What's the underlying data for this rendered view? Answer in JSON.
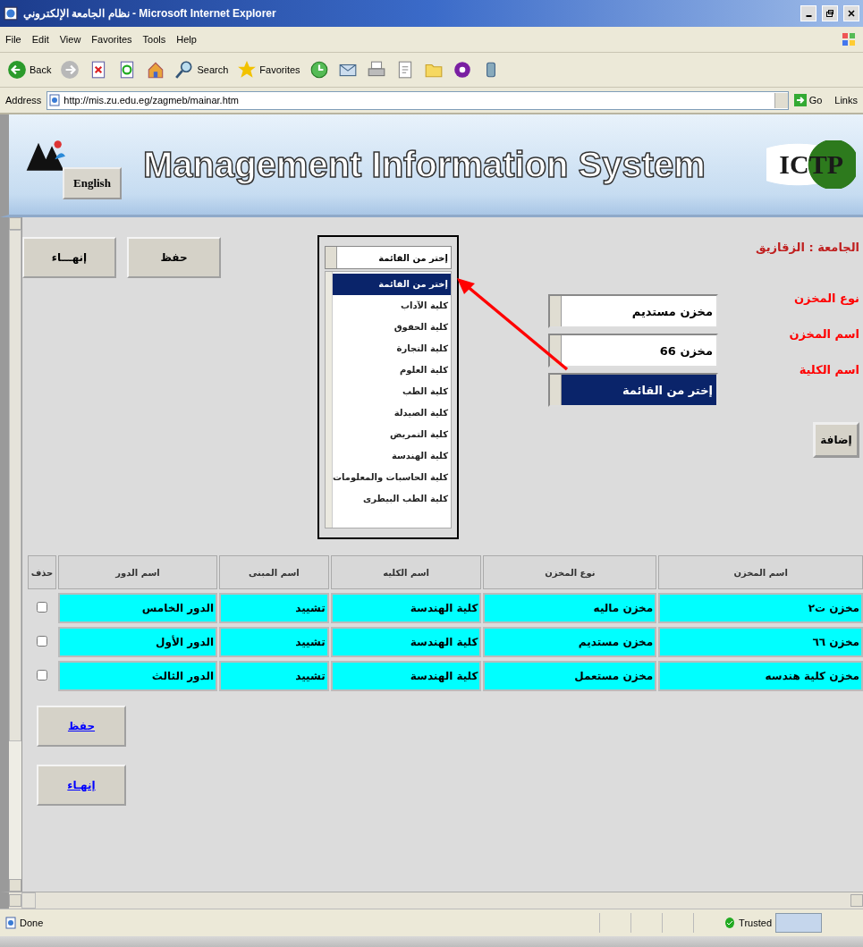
{
  "window": {
    "title": "نظام الجامعة الإلكتروني - Microsoft Internet Explorer"
  },
  "menu": {
    "file": "File",
    "edit": "Edit",
    "view": "View",
    "favorites": "Favorites",
    "tools": "Tools",
    "help": "Help"
  },
  "toolbar": {
    "back": "Back",
    "search": "Search",
    "favorites": "Favorites"
  },
  "address": {
    "label": "Address",
    "value": "http://mis.zu.edu.eg/zagmeb/mainar.htm",
    "go": "Go",
    "links": "Links"
  },
  "banner": {
    "title": "Management Information System",
    "language_button": "English",
    "logo_text": "ICTP"
  },
  "top_buttons": [
    "حفظ",
    "إنهـــاء"
  ],
  "list": {
    "header": "إختر من القائمة",
    "items": [
      {
        "label": "إختر من القائمة",
        "selected": true
      },
      {
        "label": "كلية الآداب",
        "selected": false
      },
      {
        "label": "كلية الحقوق",
        "selected": false
      },
      {
        "label": "كلية التجارة",
        "selected": false
      },
      {
        "label": "كلية العلوم",
        "selected": false
      },
      {
        "label": "كلية الطب",
        "selected": false
      },
      {
        "label": "كلية الصيدلة",
        "selected": false
      },
      {
        "label": "كلية التمريض",
        "selected": false
      },
      {
        "label": "كلية الهندسة",
        "selected": false
      },
      {
        "label": "كلية الحاسبات والمعلومات",
        "selected": false
      },
      {
        "label": "كلية الطب البيطرى",
        "selected": false
      }
    ]
  },
  "university": "الجامعة : الزقازيق",
  "fields": [
    {
      "label": "نوع المخزن",
      "value": "مخزن مستديم",
      "focused": false
    },
    {
      "label": "اسم المخزن",
      "value": "مخزن 66",
      "focused": false
    },
    {
      "label": "اسم الكلية",
      "value": "إختر من القائمة",
      "focused": true
    }
  ],
  "add_button": "إضافة",
  "table": {
    "columns": [
      "اسم المخزن",
      "نوع المخزن",
      "اسم الكليه",
      "اسم المبنى",
      "اسم الدور",
      "حذف"
    ],
    "rows": [
      {
        "cells": [
          "مخزن ت٢",
          "مخزن ماليه",
          "كلية  الهندسة",
          "تشييد",
          "الدور الخامس"
        ],
        "checked": false
      },
      {
        "cells": [
          "مخزن ٦٦",
          "مخزن مستديم",
          "كلية  الهندسة",
          "تشييد",
          "الدور الأول"
        ],
        "checked": false
      },
      {
        "cells": [
          "مخزن كلية هندسه",
          "مخزن مستعمل",
          "كلية  الهندسة",
          "تشييد",
          "الدور الثالث"
        ],
        "checked": false
      }
    ]
  },
  "bottom_buttons": [
    "حفظ",
    "إنهـاء"
  ],
  "status_bar": {
    "text": "Done",
    "zone": "Trusted"
  }
}
